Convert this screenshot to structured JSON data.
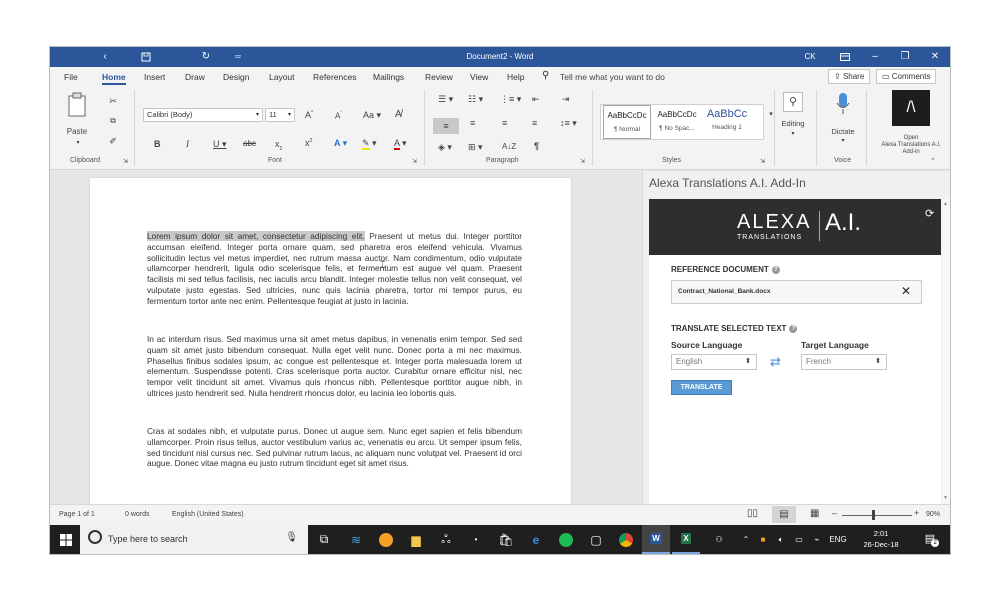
{
  "window": {
    "title": "Document2 - Word",
    "user_initials": "CK"
  },
  "menu": {
    "tabs": [
      "File",
      "Home",
      "Insert",
      "Draw",
      "Design",
      "Layout",
      "References",
      "Mailings",
      "Review",
      "View",
      "Help"
    ],
    "active": "Home",
    "tell_me": "Tell me what you want to do",
    "share": "Share",
    "comments": "Comments"
  },
  "ribbon": {
    "clipboard": {
      "paste": "Paste",
      "label": "Clipboard"
    },
    "font": {
      "name": "Calibri (Body)",
      "size": "11",
      "label": "Font"
    },
    "paragraph": {
      "label": "Paragraph"
    },
    "styles": {
      "label": "Styles",
      "items": [
        {
          "preview": "AaBbCcDc",
          "name": "¶ Normal"
        },
        {
          "preview": "AaBbCcDc",
          "name": "¶ No Spac..."
        },
        {
          "preview": "AaBbCc",
          "name": "Heading 1"
        }
      ]
    },
    "editing": {
      "label": "Editing"
    },
    "voice": {
      "dictate": "Dictate",
      "label": "Voice"
    },
    "addin": {
      "open_label": "Open",
      "name_label": "Alexa Translations A.I.",
      "sub_label": "Add-in"
    }
  },
  "document": {
    "highlight": "Lorem ipsum dolor sit amet, consectetur adipiscing elit.",
    "para1_rest": " Praesent ut metus dui. Integer porttitor accumsan eleifend. Integer porta ornare quam, sed pharetra eros eleifend vehicula. Vivamus sollicitudin lectus vel metus imperdiet, nec rutrum massa auctor. Nam condimentum, odio vulputate ullamcorper hendrerit, ligula odio scelerisque felis, et fermentum est augue vel quam. Praesent facilisis mi sed tellus facilisis, nec iaculis arcu blandit. Integer molestie tellus non velit consequat, vel vulputate justo egestas. Sed ultricies, nunc quis lacinia pharetra, tortor mi tempor purus, eu fermentum tortor ante nec enim. Pellentesque feugiat at justo in lacinia.",
    "para2": "In ac interdum risus. Sed maximus urna sit amet metus dapibus, in venenatis enim tempor. Sed sed quam sit amet justo bibendum consequat. Nulla eget velit nunc. Donec porta a mi nec maximus. Phasellus finibus sodales ipsum, ac congue est pellentesque et. Integer porta malesuada lorem ut elementum. Suspendisse potenti. Cras scelerisque porta auctor. Curabitur ornare efficitur nisl, nec tempor velit tincidunt sit amet. Vivamus quis rhoncus nibh. Pellentesque porttitor augue nibh, in ultrices justo hendrerit sed. Nulla hendrerit rhoncus dolor, eu lacinia leo lobortis quis.",
    "para3": "Cras at sodales nibh, et vulputate purus. Donec ut augue sem. Nunc eget sapien et felis bibendum ullamcorper. Proin risus tellus, auctor vestibulum varius ac, venenatis eu arcu. Ut semper ipsum felis, sed tincidunt nisl cursus nec. Sed pulvinar rutrum lacus, ac aliquam nunc volutpat vel. Praesent id orci augue. Donec vitae magna eu justo rutrum tincidunt eget sit amet risus."
  },
  "addin_pane": {
    "title": "Alexa Translations A.I. Add-In",
    "logo_text": "ALEXA",
    "logo_sub": "TRANSLATIONS",
    "logo_ai": "A.I.",
    "reference_label": "REFERENCE DOCUMENT",
    "reference_file": "Contract_National_Bank.docx",
    "translate_label": "TRANSLATE SELECTED TEXT",
    "source_label": "Source Language",
    "target_label": "Target Language",
    "source_value": "English",
    "target_value": "French",
    "translate_button": "TRANSLATE"
  },
  "status": {
    "page": "Page 1 of 1",
    "words": "0 words",
    "language": "English (United States)",
    "zoom": "90%",
    "zoom_level": 0.9
  },
  "taskbar": {
    "search_placeholder": "Type here to search",
    "lang": "ENG",
    "time": "2:01",
    "date": "26-Dec-18",
    "notif_count": "2"
  },
  "colors": {
    "word_blue": "#2b579a",
    "addin_dark": "#2e2e2e",
    "translate_button": "#5b9bd5",
    "highlight": "#c9c9c9"
  }
}
